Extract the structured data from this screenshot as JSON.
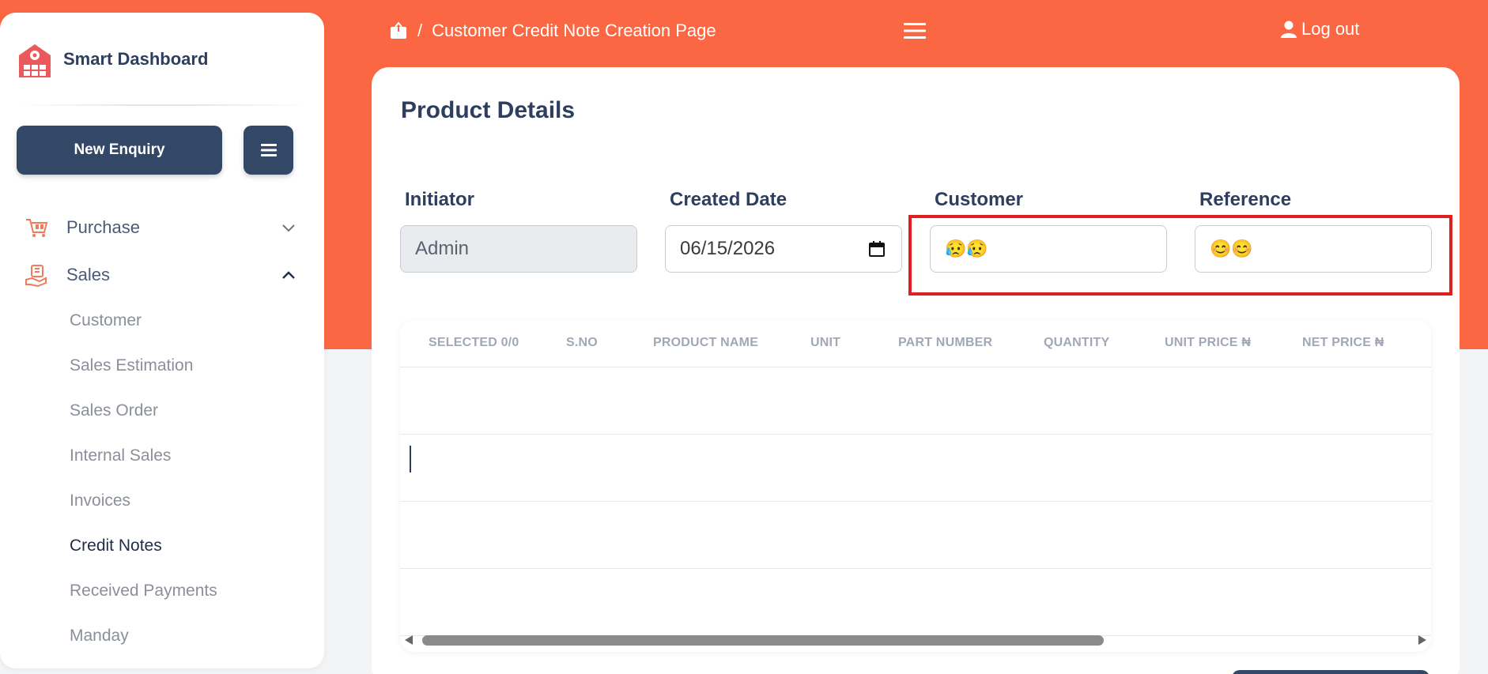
{
  "brand": {
    "name": "Smart Dashboard"
  },
  "sidebar": {
    "new_enquiry_label": "New Enquiry",
    "groups": [
      {
        "label": "Purchase",
        "expanded": false
      },
      {
        "label": "Sales",
        "expanded": true
      }
    ],
    "sales_items": [
      {
        "label": "Customer"
      },
      {
        "label": "Sales Estimation"
      },
      {
        "label": "Sales Order"
      },
      {
        "label": "Internal Sales"
      },
      {
        "label": "Invoices"
      },
      {
        "label": "Credit Notes",
        "active": true
      },
      {
        "label": "Received Payments"
      },
      {
        "label": "Manday"
      }
    ]
  },
  "header": {
    "breadcrumb_separator": "/",
    "breadcrumb_page": "Customer Credit Note Creation Page",
    "logout_label": "Log out"
  },
  "form": {
    "title": "Product Details",
    "initiator_label": "Initiator",
    "initiator_value": "Admin",
    "created_date_label": "Created Date",
    "created_date_value": "06/15/2026",
    "customer_label": "Customer",
    "customer_value": "😥😥",
    "reference_label": "Reference",
    "reference_value": "😊😊"
  },
  "table": {
    "columns": [
      "SELECTED 0/0",
      "S.NO",
      "PRODUCT NAME",
      "UNIT",
      "PART NUMBER",
      "QUANTITY",
      "UNIT PRICE ₦",
      "NET PRICE ₦"
    ],
    "rows": []
  },
  "colors": {
    "accent": "#fa6742",
    "navy": "#334766",
    "highlight": "#e0201e"
  }
}
